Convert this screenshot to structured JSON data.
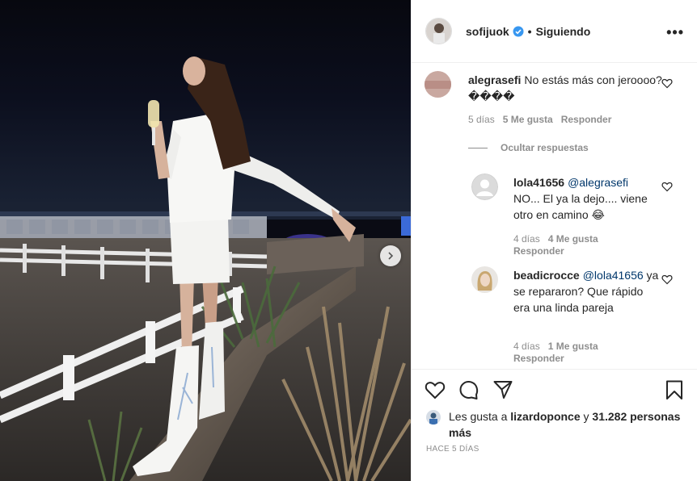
{
  "post": {
    "username": "sofijuok",
    "verified": true,
    "follow_status": "Siguiendo",
    "more_label": "•••"
  },
  "comments": [
    {
      "username": "alegrasefi",
      "text": "No estás más con jeroooo? ����",
      "age": "5 días",
      "likes": "5 Me gusta",
      "reply_label": "Responder"
    }
  ],
  "hide_replies_label": "Ocultar respuestas",
  "replies": [
    {
      "username": "lola41656",
      "mention": "@alegrasefi",
      "text": "NO... El ya la dejo.... viene otro en camino 😂",
      "age": "4 días",
      "likes": "4 Me gusta",
      "reply_label": "Responder"
    },
    {
      "username": "beadicrocce",
      "mention": "@lola41656",
      "text": "ya se repararon? Que rápido era una linda pareja",
      "age": "4 días",
      "likes": "1 Me gusta",
      "reply_label": "Responder"
    }
  ],
  "likes_summary": {
    "prefix": "Les gusta a",
    "liker": "lizardoponce",
    "joiner": "y",
    "others": "31.282 personas más"
  },
  "timestamp": "HACE 5 DÍAS",
  "colors": {
    "verified_blue": "#3897f0",
    "text": "#262626",
    "muted": "#8e8e8e",
    "mention": "#00376b"
  }
}
